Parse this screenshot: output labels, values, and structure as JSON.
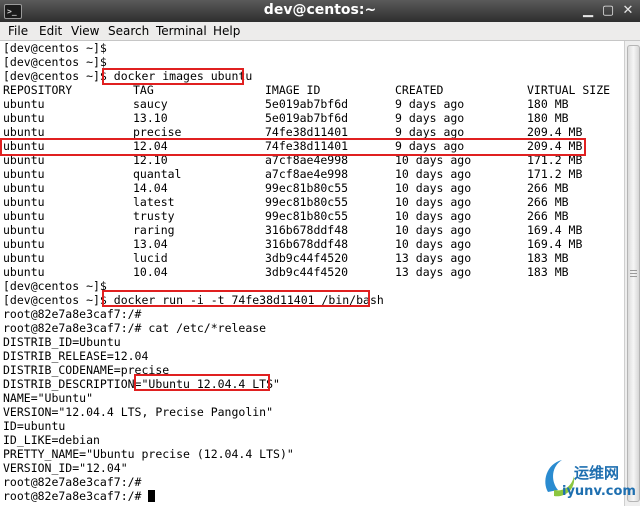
{
  "window": {
    "title": "dev@centos:~",
    "terminal_icon": ">_",
    "minimize_glyph": "▁",
    "maximize_glyph": "▢",
    "close_glyph": "✕"
  },
  "menu": {
    "items": [
      "File",
      "Edit",
      "View",
      "Search",
      "Terminal",
      "Help"
    ]
  },
  "terminal": {
    "before": [
      "[dev@centos ~]$",
      "[dev@centos ~]$"
    ],
    "prompt": "[dev@centos ~]$ ",
    "cmd_images": "docker images ubuntu",
    "table_header": [
      "REPOSITORY",
      "TAG",
      "IMAGE ID",
      "CREATED",
      "VIRTUAL SIZE"
    ],
    "rows": [
      [
        "ubuntu",
        "saucy",
        "5e019ab7bf6d",
        "9 days ago",
        "180 MB"
      ],
      [
        "ubuntu",
        "13.10",
        "5e019ab7bf6d",
        "9 days ago",
        "180 MB"
      ],
      [
        "ubuntu",
        "precise",
        "74fe38d11401",
        "9 days ago",
        "209.4 MB"
      ],
      [
        "ubuntu",
        "12.04",
        "74fe38d11401",
        "9 days ago",
        "209.4 MB"
      ],
      [
        "ubuntu",
        "12.10",
        "a7cf8ae4e998",
        "10 days ago",
        "171.2 MB"
      ],
      [
        "ubuntu",
        "quantal",
        "a7cf8ae4e998",
        "10 days ago",
        "171.2 MB"
      ],
      [
        "ubuntu",
        "14.04",
        "99ec81b80c55",
        "10 days ago",
        "266 MB"
      ],
      [
        "ubuntu",
        "latest",
        "99ec81b80c55",
        "10 days ago",
        "266 MB"
      ],
      [
        "ubuntu",
        "trusty",
        "99ec81b80c55",
        "10 days ago",
        "266 MB"
      ],
      [
        "ubuntu",
        "raring",
        "316b678ddf48",
        "10 days ago",
        "169.4 MB"
      ],
      [
        "ubuntu",
        "13.04",
        "316b678ddf48",
        "10 days ago",
        "169.4 MB"
      ],
      [
        "ubuntu",
        "lucid",
        "3db9c44f4520",
        "13 days ago",
        "183 MB"
      ],
      [
        "ubuntu",
        "10.04",
        "3db9c44f4520",
        "13 days ago",
        "183 MB"
      ]
    ],
    "highlighted_row": 3,
    "after_table": "[dev@centos ~]$",
    "cmd_run": "docker run -i -t 74fe38d11401 /bin/bash",
    "root_prompt_line": "root@82e7a8e3caf7:/#",
    "root_prompt": "root@82e7a8e3caf7:/# ",
    "cmd_cat": "cat /etc/*release",
    "release_lines_a": [
      "DISTRIB_ID=Ubuntu",
      "DISTRIB_RELEASE=12.04",
      "DISTRIB_CODENAME=precise"
    ],
    "desc_key": "DISTRIB_DESCRIPTION=",
    "desc_value": "\"Ubuntu 12.04.4 LTS\"",
    "release_lines_b": [
      "NAME=\"Ubuntu\"",
      "VERSION=\"12.04.4 LTS, Precise Pangolin\"",
      "ID=ubuntu",
      "ID_LIKE=debian",
      "PRETTY_NAME=\"Ubuntu precise (12.04.4 LTS)\"",
      "VERSION_ID=\"12.04\""
    ]
  },
  "watermark": {
    "cn_text": "运维网",
    "url": "iyunv.com"
  },
  "colors": {
    "highlight_box": "#e02020",
    "highlight_row_bg": "#e4e4f0",
    "watermark_blue": "#1e6fb0"
  }
}
